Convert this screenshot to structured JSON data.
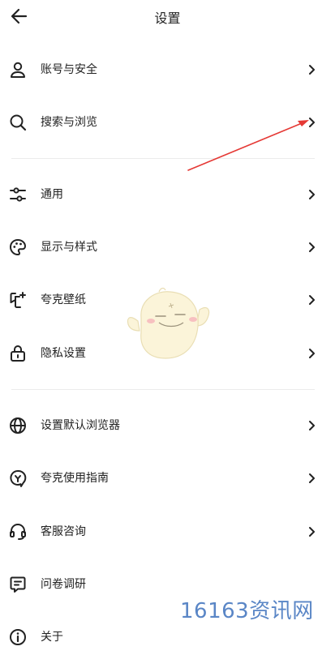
{
  "header": {
    "title": "设置"
  },
  "sections": [
    {
      "items": [
        {
          "label": "账号与安全",
          "icon": "user-icon"
        },
        {
          "label": "搜索与浏览",
          "icon": "search-icon"
        }
      ]
    },
    {
      "items": [
        {
          "label": "通用",
          "icon": "sliders-icon"
        },
        {
          "label": "显示与样式",
          "icon": "palette-icon"
        },
        {
          "label": "夸克壁纸",
          "icon": "wallpaper-icon"
        },
        {
          "label": "隐私设置",
          "icon": "lock-icon"
        }
      ]
    },
    {
      "items": [
        {
          "label": "设置默认浏览器",
          "icon": "globe-icon"
        },
        {
          "label": "夸克使用指南",
          "icon": "guide-icon"
        },
        {
          "label": "客服咨询",
          "icon": "headset-icon"
        },
        {
          "label": "问卷调研",
          "icon": "survey-icon"
        },
        {
          "label": "关于",
          "icon": "info-icon"
        }
      ]
    }
  ],
  "watermark": "16163资讯网",
  "colors": {
    "annotation_arrow": "#e53935",
    "watermark": "#5a86c6"
  }
}
